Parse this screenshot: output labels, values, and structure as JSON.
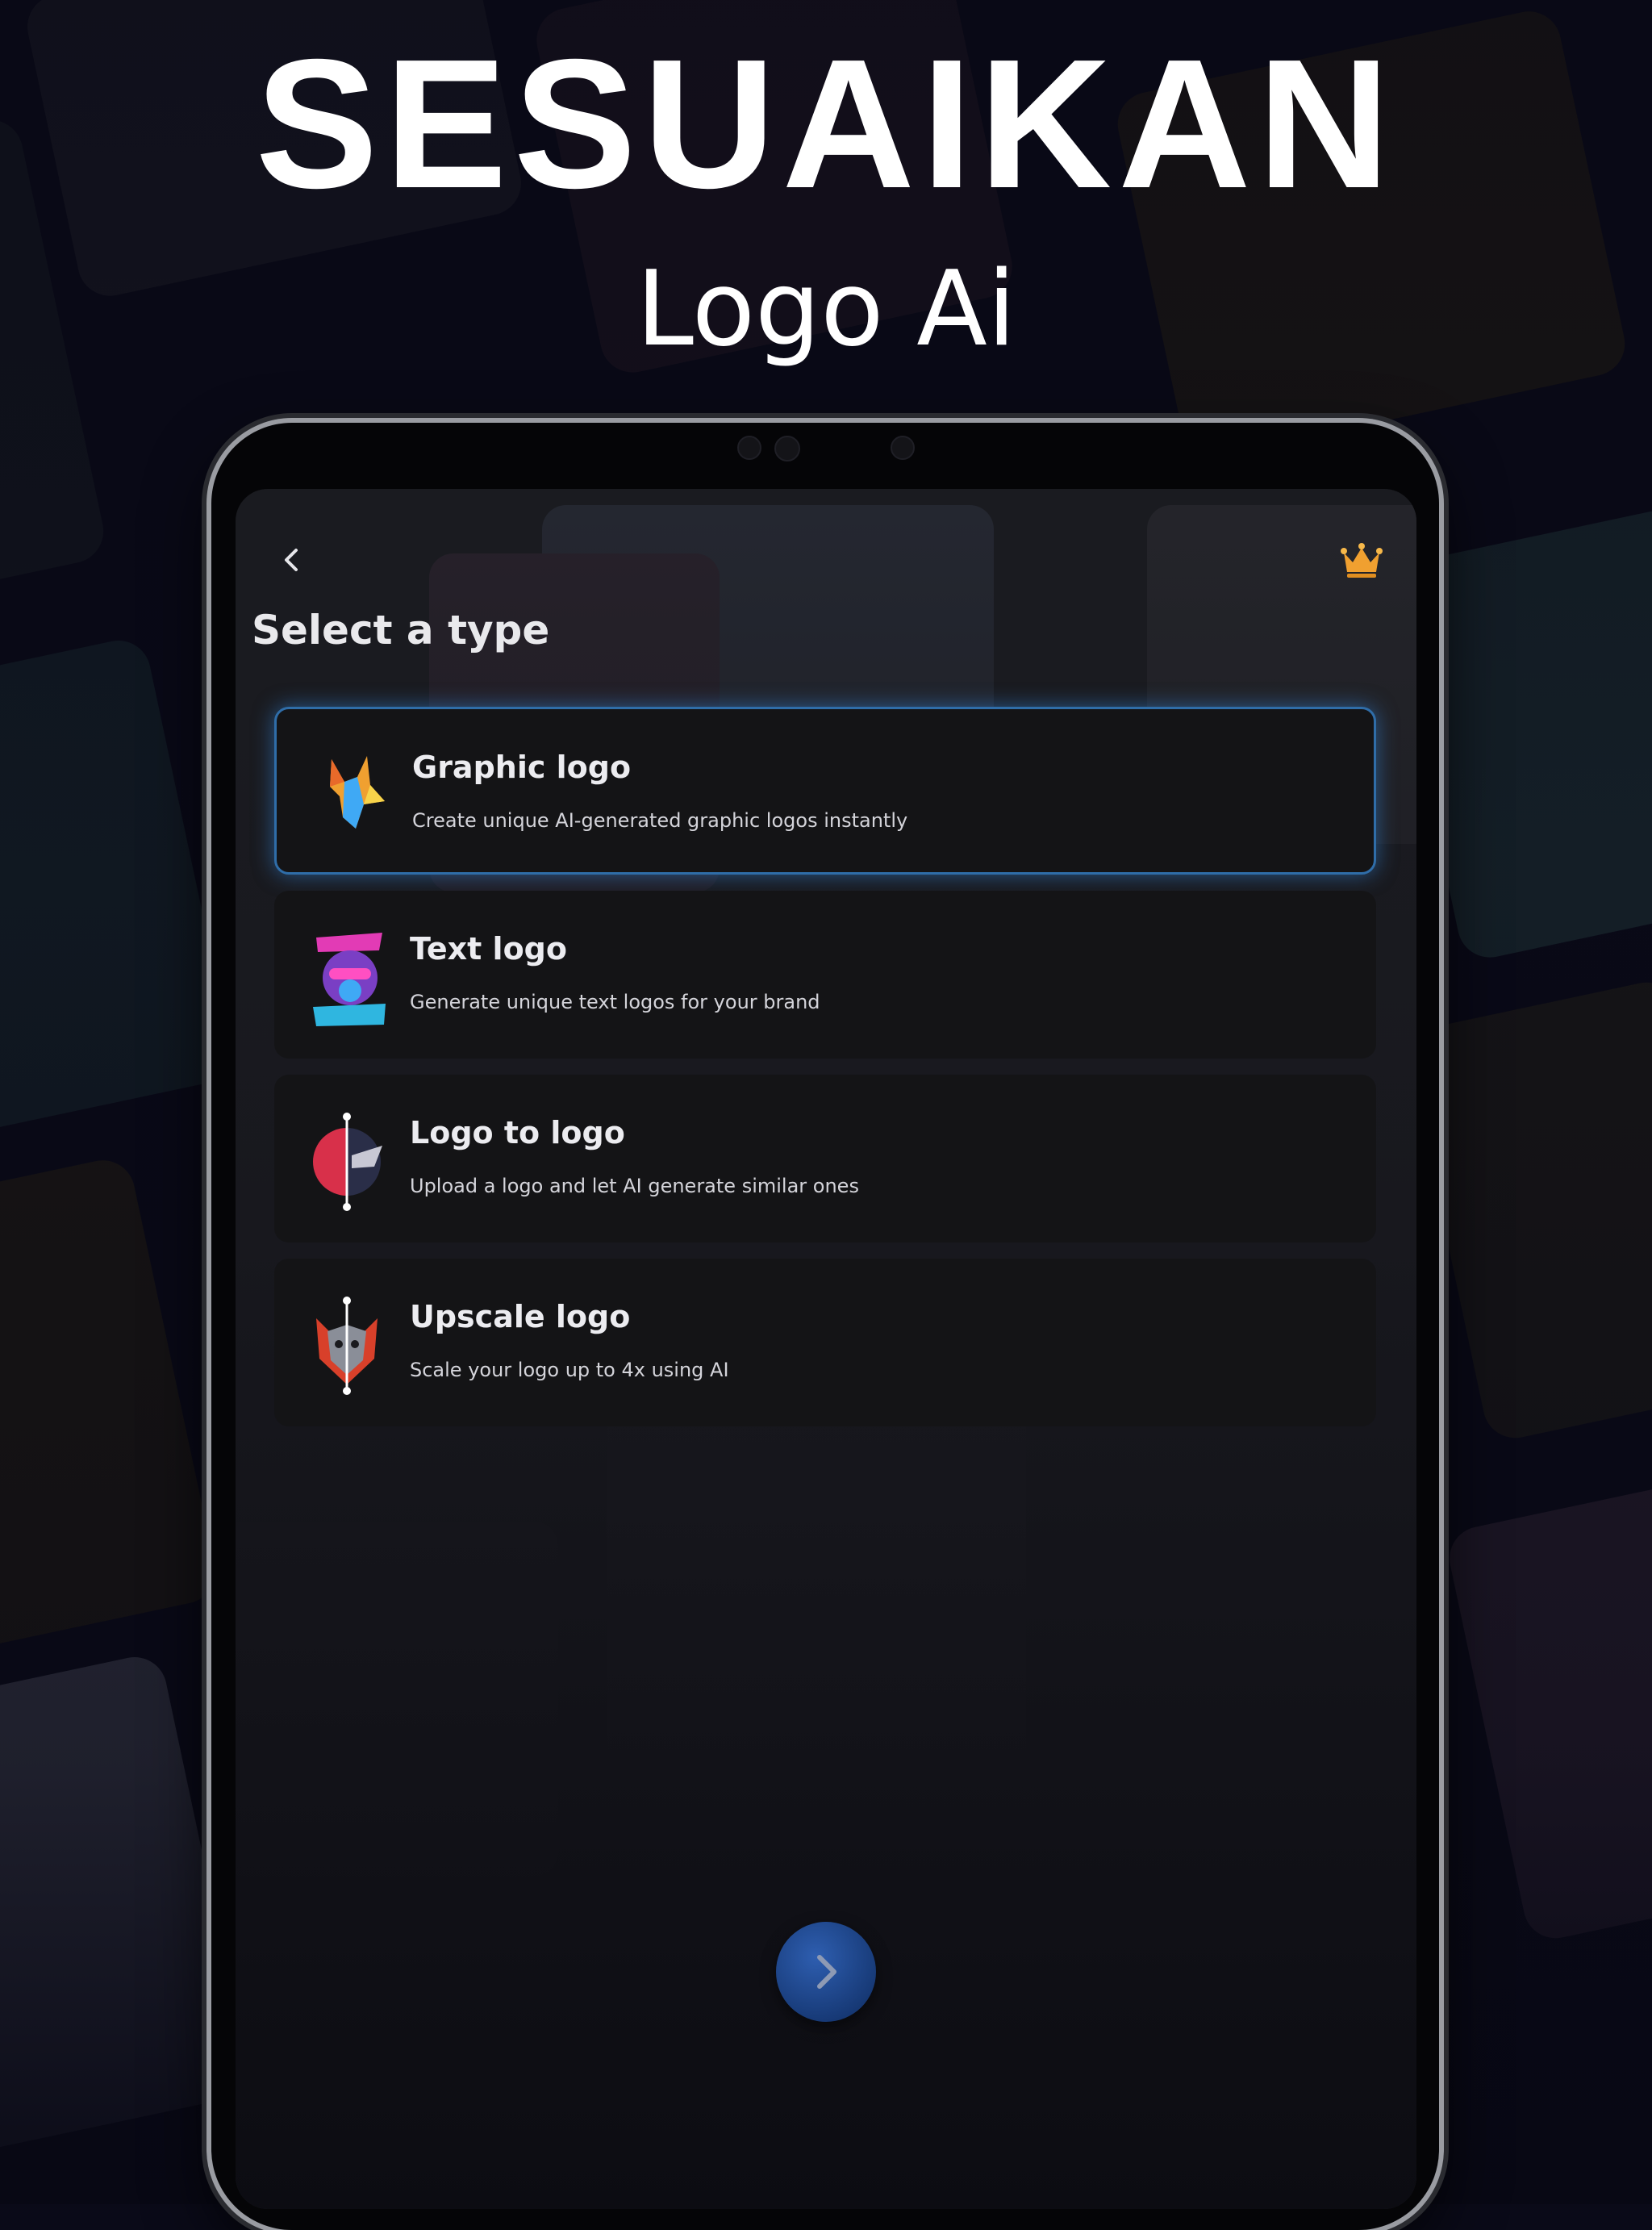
{
  "promo": {
    "headline": "SESUAIKAN",
    "subheadline": "Logo Ai"
  },
  "screen": {
    "back_icon": "chevron-left-icon",
    "premium_icon": "crown-icon",
    "title": "Select a type",
    "types": [
      {
        "title": "Graphic logo",
        "description": "Create unique AI-generated graphic logos instantly",
        "icon": "fox-logo-icon",
        "selected": true
      },
      {
        "title": "Text logo",
        "description": "Generate unique text logos for your brand",
        "icon": "gorilla-text-logo-icon",
        "selected": false
      },
      {
        "title": "Logo to logo",
        "description": "Upload a logo and let AI generate similar ones",
        "icon": "logo-compare-icon",
        "selected": false
      },
      {
        "title": "Upscale logo",
        "description": "Scale your logo up to 4x using AI",
        "icon": "wolf-upscale-icon",
        "selected": false
      }
    ],
    "next_icon": "chevron-right-icon"
  },
  "colors": {
    "background": "#0a0a18",
    "card": "#141416",
    "selected_border": "#2f6da8",
    "next_button": "#1e4a94",
    "crown": "#f0a030"
  }
}
